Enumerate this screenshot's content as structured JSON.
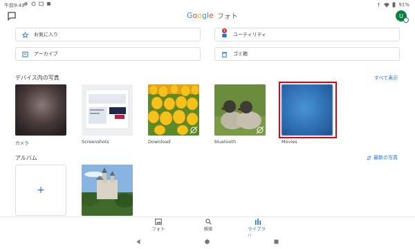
{
  "status": {
    "time": "午前9:49",
    "battery": "91%"
  },
  "header": {
    "brand_parts": [
      "G",
      "o",
      "o",
      "g",
      "l",
      "e"
    ],
    "app": "フォト",
    "avatar_initial": "U"
  },
  "quick": [
    {
      "label": "お気に入り",
      "icon": "star-icon"
    },
    {
      "label": "ユーティリティ",
      "icon": "utility-icon",
      "badge": "1"
    },
    {
      "label": "アーカイブ",
      "icon": "archive-icon"
    },
    {
      "label": "ゴミ箱",
      "icon": "trash-icon"
    }
  ],
  "device": {
    "title": "デバイス内の写真",
    "show_all": "すべて表示",
    "folders": [
      {
        "name": "カメラ"
      },
      {
        "name": "Screenshots"
      },
      {
        "name": "Download"
      },
      {
        "name": "bluetooth"
      },
      {
        "name": "Movies"
      }
    ]
  },
  "albums": {
    "title": "アルバム",
    "sort": "最新の写真",
    "add_symbol": "+"
  },
  "nav": [
    {
      "label": "フォト"
    },
    {
      "label": "検索"
    },
    {
      "label": "ライブラリ"
    }
  ],
  "colors": {
    "accent": "#1a73e8",
    "highlight": "#e3000f"
  }
}
